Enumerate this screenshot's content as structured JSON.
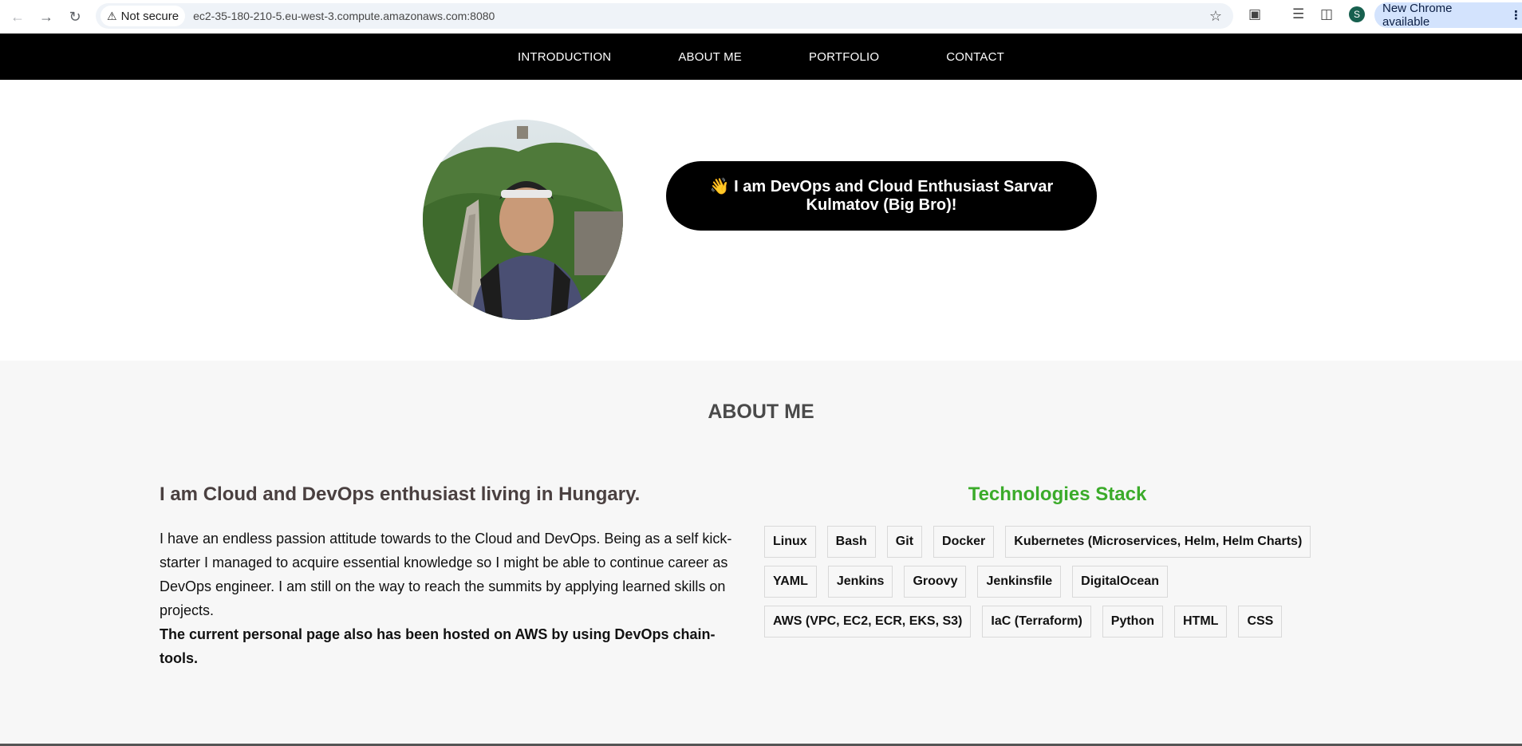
{
  "browser": {
    "security_label": "Not secure",
    "url": "ec2-35-180-210-5.eu-west-3.compute.amazonaws.com:8080",
    "profile_initial": "S",
    "update_label": "New Chrome available",
    "icons": [
      "back-icon",
      "forward-icon",
      "reload-icon",
      "warning-icon",
      "star-icon",
      "extensions-icon",
      "media-icon",
      "sidepanel-icon",
      "menu-icon"
    ]
  },
  "nav": {
    "items": [
      "INTRODUCTION",
      "ABOUT ME",
      "PORTFOLIO",
      "CONTACT"
    ]
  },
  "hero": {
    "greeting": "👋 I am DevOps and Cloud Enthusiast Sarvar Kulmatov (Big Bro)!"
  },
  "about": {
    "title": "ABOUT ME",
    "heading": "I am Cloud and DevOps enthusiast living in Hungary.",
    "paragraph": "I have an endless passion attitude towards to the Cloud and DevOps. Being as a self kick-starter I managed to acquire essential knowledge so I might be able to continue career as DevOps engineer. I am still on the way to reach the summits by applying learned skills on projects.",
    "strong": "The current personal page also has been hosted on AWS by using DevOps chain-tools.",
    "stack_title": "Technologies Stack",
    "stack_color": "#3bab2a",
    "tags_rows": [
      [
        "Linux",
        "Bash",
        "Git",
        "Docker",
        "Kubernetes (Microservices, Helm, Helm Charts)"
      ],
      [
        "YAML",
        "Jenkins",
        "Groovy",
        "Jenkinsfile",
        "DigitalOcean"
      ],
      [
        "AWS (VPC, EC2, ECR, EKS, S3)",
        "IaC (Terraform)",
        "Python",
        "HTML",
        "CSS"
      ]
    ]
  }
}
